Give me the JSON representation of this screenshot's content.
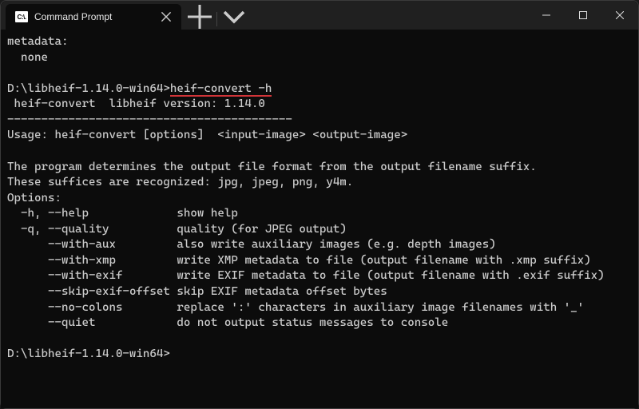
{
  "window": {
    "tab_title": "Command Prompt",
    "tab_icon_label": "C:\\.",
    "icons": {
      "close_tab": "close-icon",
      "new_tab": "plus-icon",
      "chevron": "chevron-down-icon",
      "minimize": "minimize-icon",
      "maximize": "maximize-icon",
      "close": "close-icon"
    }
  },
  "terminal": {
    "pre_output": "metadata:\n  none\n",
    "prompt1_path": "D:\\libheif-1.14.0-win64>",
    "prompt1_cmd": "heif-convert -h",
    "version_line": " heif-convert  libheif version: 1.14.0",
    "sep": "------------------------------------------",
    "usage": "Usage: heif-convert [options]  <input-image> <output-image>",
    "desc1": "The program determines the output file format from the output filename suffix.",
    "desc2": "These suffices are recognized: jpg, jpeg, png, y4m.",
    "options_header": "Options:",
    "options": [
      "  -h, --help             show help",
      "  -q, --quality          quality (for JPEG output)",
      "      --with-aux         also write auxiliary images (e.g. depth images)",
      "      --with-xmp         write XMP metadata to file (output filename with .xmp suffix)",
      "      --with-exif        write EXIF metadata to file (output filename with .exif suffix)",
      "      --skip-exif-offset skip EXIF metadata offset bytes",
      "      --no-colons        replace ':' characters in auxiliary image filenames with '_'",
      "      --quiet            do not output status messages to console"
    ],
    "prompt2_path": "D:\\libheif-1.14.0-win64>"
  }
}
